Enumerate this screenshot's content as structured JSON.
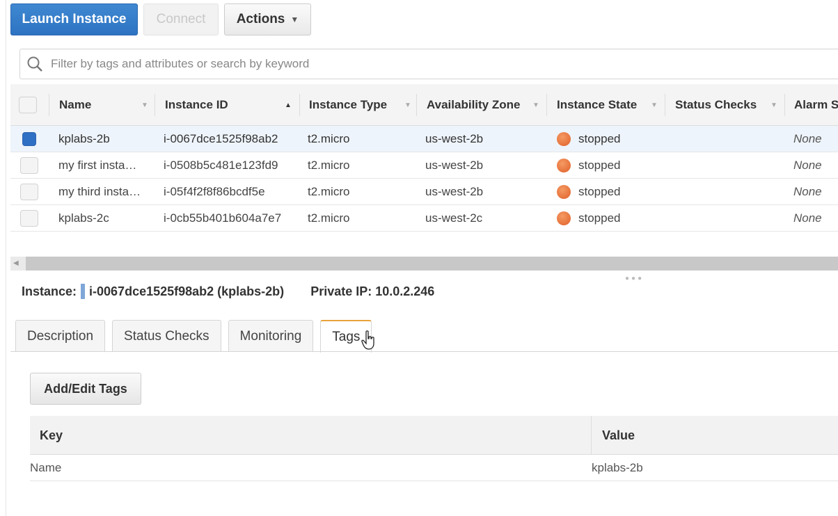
{
  "toolbar": {
    "launch_label": "Launch Instance",
    "connect_label": "Connect",
    "actions_label": "Actions"
  },
  "search": {
    "placeholder": "Filter by tags and attributes or search by keyword"
  },
  "instances_table": {
    "columns": [
      "Name",
      "Instance ID",
      "Instance Type",
      "Availability Zone",
      "Instance State",
      "Status Checks",
      "Alarm S"
    ],
    "rows": [
      {
        "name": "kplabs-2b",
        "id": "i-0067dce1525f98ab2",
        "type": "t2.micro",
        "zone": "us-west-2b",
        "state": "stopped",
        "alarm": "None",
        "selected": true
      },
      {
        "name": "my first insta…",
        "id": "i-0508b5c481e123fd9",
        "type": "t2.micro",
        "zone": "us-west-2b",
        "state": "stopped",
        "alarm": "None",
        "selected": false
      },
      {
        "name": "my third insta…",
        "id": "i-05f4f2f8f86bcdf5e",
        "type": "t2.micro",
        "zone": "us-west-2b",
        "state": "stopped",
        "alarm": "None",
        "selected": false
      },
      {
        "name": "kplabs-2c",
        "id": "i-0cb55b401b604a7e7",
        "type": "t2.micro",
        "zone": "us-west-2c",
        "state": "stopped",
        "alarm": "None",
        "selected": false
      }
    ]
  },
  "instance_info": {
    "label": "Instance:",
    "value": "i-0067dce1525f98ab2 (kplabs-2b)",
    "private_ip": "Private IP: 10.0.2.246"
  },
  "tabs": [
    {
      "label": "Description",
      "active": false
    },
    {
      "label": "Status Checks",
      "active": false
    },
    {
      "label": "Monitoring",
      "active": false
    },
    {
      "label": "Tags",
      "active": true
    }
  ],
  "tags_panel": {
    "add_edit_label": "Add/Edit Tags",
    "columns": {
      "key": "Key",
      "value": "Value"
    },
    "rows": [
      {
        "key": "Name",
        "value": "kplabs-2b"
      }
    ]
  },
  "colors": {
    "primary": "#2d73c2",
    "state_stopped": "#e0602a",
    "active_tab": "#e9a23b"
  }
}
